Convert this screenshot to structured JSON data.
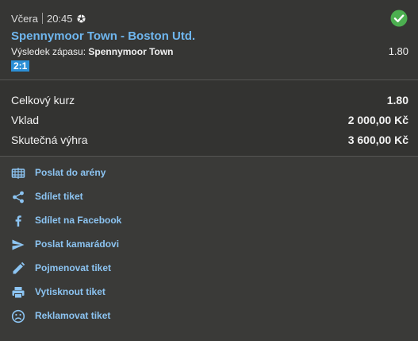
{
  "bet": {
    "day": "Včera",
    "time": "20:45",
    "match": "Spennymoor Town - Boston Utd.",
    "market_label": "Výsledek zápasu:",
    "selection": "Spennymoor Town",
    "odd": "1.80",
    "score": "2:1",
    "status_icon": "check-circle-icon",
    "sport_icon": "soccer-ball-icon"
  },
  "summary": {
    "total_odds_label": "Celkový kurz",
    "total_odds_value": "1.80",
    "stake_label": "Vklad",
    "stake_value": "2 000,00 Kč",
    "win_label": "Skutečná výhra",
    "win_value": "3 600,00 Kč"
  },
  "actions": [
    {
      "label": "Poslat do arény",
      "icon": "arena-icon"
    },
    {
      "label": "Sdílet tiket",
      "icon": "share-icon"
    },
    {
      "label": "Sdílet na Facebook",
      "icon": "facebook-icon"
    },
    {
      "label": "Poslat kamarádovi",
      "icon": "send-icon"
    },
    {
      "label": "Pojmenovat tiket",
      "icon": "pencil-icon"
    },
    {
      "label": "Vytisknout tiket",
      "icon": "printer-icon"
    },
    {
      "label": "Reklamovat tiket",
      "icon": "sad-face-icon"
    }
  ],
  "colors": {
    "accent": "#6fb6ee",
    "success": "#4caf50",
    "score_badge": "#2b8fd6",
    "background": "#3a3a38"
  }
}
